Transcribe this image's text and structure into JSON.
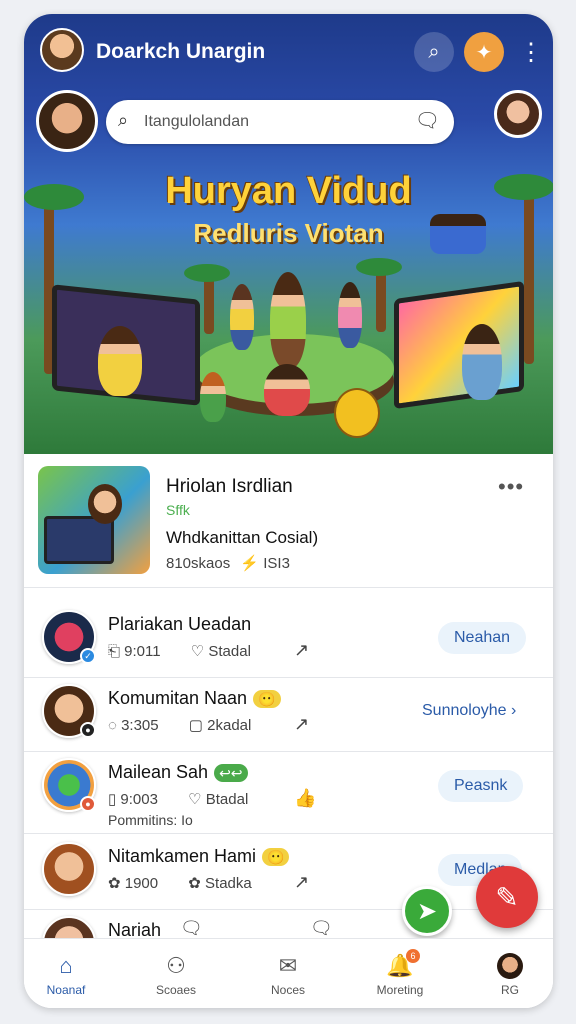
{
  "header": {
    "app_title": "Doarkch Unargin",
    "search_icon": "search-icon",
    "fire_icon": "fire-icon",
    "more_icon": "more-vertical-icon"
  },
  "search": {
    "placeholder": "Itangulolandan",
    "icon": "search-icon",
    "chat_icon": "chat-bubble-icon"
  },
  "hero": {
    "title": "Huryan Vidud",
    "subtitle": "Redluris Viotan"
  },
  "feature": {
    "title": "Hriolan Isrdlian",
    "tag": "Sffk",
    "description": "Whdkanittan Cosial)",
    "meta_left": "810skaos",
    "meta_right": "⚡ ISI3",
    "more_icon": "more-horizontal-icon"
  },
  "rows": [
    {
      "name": "Plariakan Ueadan",
      "emoji": "",
      "meta_a": "⎗ 9:011",
      "meta_b": "♡ Stadal",
      "action": "Neahan",
      "action_type": "pill",
      "badge_color": "#2b8ae0",
      "avatar_colors": [
        "#e04060",
        "#1a2a4a"
      ]
    },
    {
      "name": "Komumitan Naan",
      "emoji": "😶",
      "meta_a": "◌ 3:305",
      "meta_b": "▢ 2kadal",
      "action": "Sunnoloyhe  ›",
      "action_type": "link",
      "badge_color": "#222222",
      "avatar_colors": [
        "#f0c098",
        "#4a2a14"
      ]
    },
    {
      "name": "Mailean Sah",
      "emoji": "↩↩",
      "meta_a": "▯ 9:003",
      "meta_b": "♡ Btadal",
      "extra": "Pommitins:   Io",
      "action": "Peasnk",
      "action_type": "pill",
      "badge_color": "#e05a3a",
      "avatar_colors": [
        "#3a7ad0",
        "#f2a040"
      ]
    },
    {
      "name": "Nitamkamen Hami",
      "emoji": "😶",
      "meta_a": "✿ 1900",
      "meta_b": "✿ Stadka",
      "action": "Medlan",
      "action_type": "pill",
      "badge_color": "#f2a040",
      "avatar_colors": [
        "#f0c098",
        "#a05020"
      ]
    },
    {
      "name": "Nariah",
      "emoji": "",
      "meta_a": "",
      "meta_b": "",
      "action": "",
      "action_type": "none",
      "badge_color": "",
      "avatar_colors": [
        "#f0c0a0",
        "#5a3420"
      ]
    }
  ],
  "fabs": {
    "green_icon": "send-icon",
    "red_icon": "edit-pencil-icon"
  },
  "nav": [
    {
      "label": "Noanaf",
      "icon": "home-icon",
      "active": true
    },
    {
      "label": "Scoaes",
      "icon": "people-icon",
      "active": false
    },
    {
      "label": "Noces",
      "icon": "mail-icon",
      "active": false
    },
    {
      "label": "Moreting",
      "icon": "bell-icon",
      "active": false,
      "badge": "6"
    },
    {
      "label": "RG",
      "icon": "profile-avatar",
      "active": false
    }
  ],
  "colors": {
    "primary": "#1e3a8a",
    "accent_blue": "#2b5ba8",
    "fab_green": "#3aaa3a",
    "fab_red": "#e03a3a",
    "tag_green": "#4caf50"
  }
}
